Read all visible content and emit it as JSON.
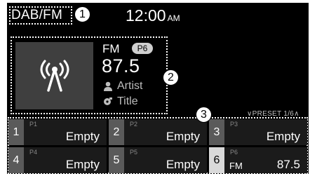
{
  "source": "DAB/FM",
  "clock": {
    "time": "12:00",
    "ampm": "AM"
  },
  "callouts": [
    "1",
    "2",
    "3"
  ],
  "station": {
    "band": "FM",
    "preset_badge": "P6",
    "frequency": "87.5",
    "artist": "Artist",
    "title": "Title",
    "art_icon": "radio-antenna-icon"
  },
  "preset_indicator": "∨PRESET 1/6∧",
  "presets": [
    {
      "num": "1",
      "label": "P1",
      "value": "Empty",
      "active": false
    },
    {
      "num": "2",
      "label": "P2",
      "value": "Empty",
      "active": false
    },
    {
      "num": "3",
      "label": "P3",
      "value": "Empty",
      "active": false
    },
    {
      "num": "4",
      "label": "P4",
      "value": "Empty",
      "active": false
    },
    {
      "num": "5",
      "label": "P5",
      "value": "Empty",
      "active": false
    },
    {
      "num": "6",
      "label": "P6",
      "band": "FM",
      "value": "87.5",
      "active": true
    }
  ],
  "colors": {
    "background": "#000000",
    "active_preset": "#d9d9d9",
    "tile": "#1b1b1b"
  }
}
